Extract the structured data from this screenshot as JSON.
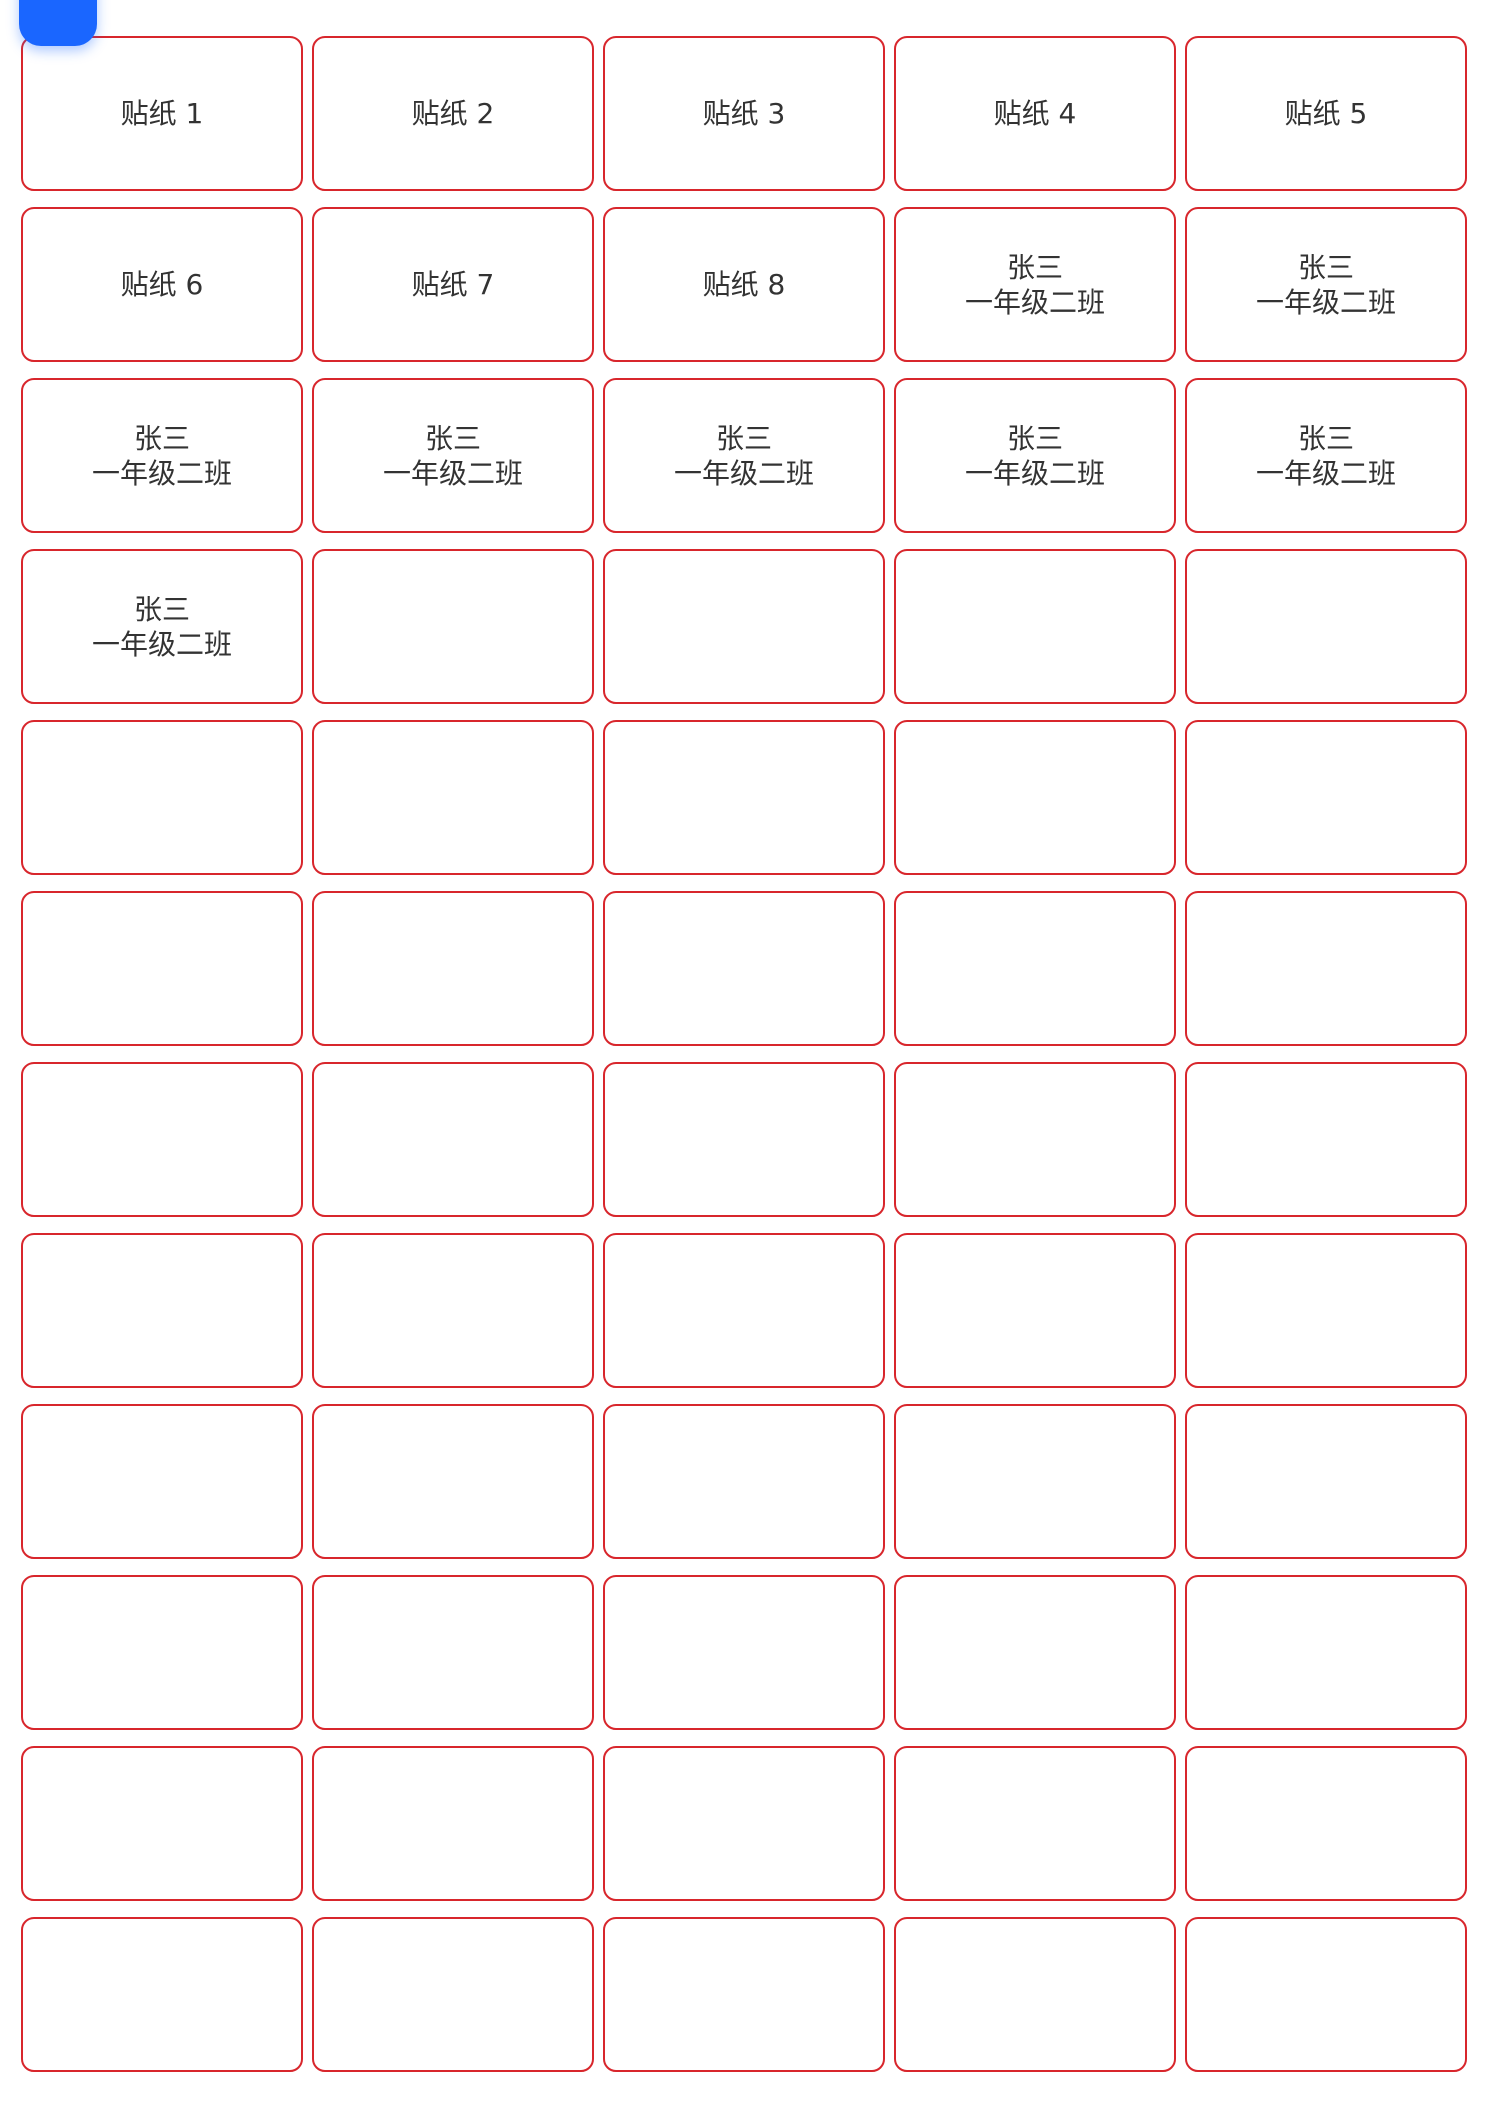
{
  "colors": {
    "fab": "#1a66ff",
    "sticker_border": "#d8262c",
    "sticker_text": "#333333"
  },
  "fab": {
    "icon": "rounded-square"
  },
  "stickers": [
    {
      "lines": [
        "贴纸 1"
      ]
    },
    {
      "lines": [
        "贴纸 2"
      ]
    },
    {
      "lines": [
        "贴纸 3"
      ]
    },
    {
      "lines": [
        "贴纸 4"
      ]
    },
    {
      "lines": [
        "贴纸 5"
      ]
    },
    {
      "lines": [
        "贴纸 6"
      ]
    },
    {
      "lines": [
        "贴纸 7"
      ]
    },
    {
      "lines": [
        "贴纸 8"
      ]
    },
    {
      "lines": [
        "张三",
        "一年级二班"
      ]
    },
    {
      "lines": [
        "张三",
        "一年级二班"
      ]
    },
    {
      "lines": [
        "张三",
        "一年级二班"
      ]
    },
    {
      "lines": [
        "张三",
        "一年级二班"
      ]
    },
    {
      "lines": [
        "张三",
        "一年级二班"
      ]
    },
    {
      "lines": [
        "张三",
        "一年级二班"
      ]
    },
    {
      "lines": [
        "张三",
        "一年级二班"
      ]
    },
    {
      "lines": [
        "张三",
        "一年级二班"
      ]
    },
    {
      "lines": []
    },
    {
      "lines": []
    },
    {
      "lines": []
    },
    {
      "lines": []
    },
    {
      "lines": []
    },
    {
      "lines": []
    },
    {
      "lines": []
    },
    {
      "lines": []
    },
    {
      "lines": []
    },
    {
      "lines": []
    },
    {
      "lines": []
    },
    {
      "lines": []
    },
    {
      "lines": []
    },
    {
      "lines": []
    },
    {
      "lines": []
    },
    {
      "lines": []
    },
    {
      "lines": []
    },
    {
      "lines": []
    },
    {
      "lines": []
    },
    {
      "lines": []
    },
    {
      "lines": []
    },
    {
      "lines": []
    },
    {
      "lines": []
    },
    {
      "lines": []
    },
    {
      "lines": []
    },
    {
      "lines": []
    },
    {
      "lines": []
    },
    {
      "lines": []
    },
    {
      "lines": []
    },
    {
      "lines": []
    },
    {
      "lines": []
    },
    {
      "lines": []
    },
    {
      "lines": []
    },
    {
      "lines": []
    },
    {
      "lines": []
    },
    {
      "lines": []
    },
    {
      "lines": []
    },
    {
      "lines": []
    },
    {
      "lines": []
    },
    {
      "lines": []
    },
    {
      "lines": []
    },
    {
      "lines": []
    },
    {
      "lines": []
    },
    {
      "lines": []
    }
  ]
}
